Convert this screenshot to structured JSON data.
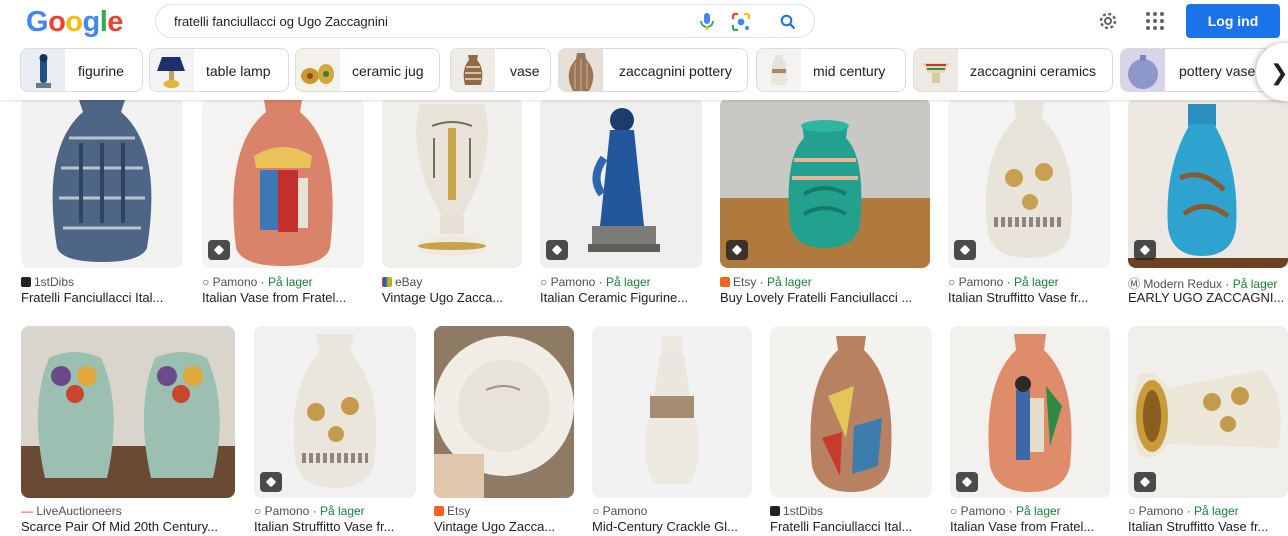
{
  "logo": {
    "letters": [
      "G",
      "o",
      "o",
      "g",
      "l",
      "e"
    ],
    "colors": [
      "#4285F4",
      "#EA4335",
      "#FBBC05",
      "#4285F4",
      "#34A853",
      "#EA4335"
    ]
  },
  "search": {
    "query": "fratelli fanciullacci og Ugo Zaccagnini",
    "icons": [
      "microphone-icon",
      "lens-icon",
      "search-icon"
    ]
  },
  "header": {
    "login_label": "Log ind",
    "settings_icon": "gear-icon",
    "apps_icon": "apps-grid-icon"
  },
  "chips": [
    {
      "label": "figurine"
    },
    {
      "label": "table lamp"
    },
    {
      "label": "ceramic jug"
    },
    {
      "label": "vase"
    },
    {
      "label": "zaccagnini pottery"
    },
    {
      "label": "mid century"
    },
    {
      "label": "zaccagnini ceramics"
    },
    {
      "label": "pottery vase"
    }
  ],
  "colors": {
    "accent": "#1a73e8",
    "stock": "#188038"
  },
  "results": [
    {
      "source": "1stDibs",
      "stock": "",
      "title": "Fratelli Fanciullacci Ital..."
    },
    {
      "source": "Pamono",
      "stock": "På lager",
      "title": "Italian Vase from Fratel..."
    },
    {
      "source": "eBay",
      "stock": "",
      "title": "Vintage Ugo Zacca..."
    },
    {
      "source": "Pamono",
      "stock": "På lager",
      "title": "Italian Ceramic Figurine..."
    },
    {
      "source": "Etsy",
      "stock": "På lager",
      "title": "Buy Lovely Fratelli Fanciullacci ..."
    },
    {
      "source": "Pamono",
      "stock": "På lager",
      "title": "Italian Struffitto Vase fr..."
    },
    {
      "source": "Modern Redux",
      "stock": "På lager",
      "title": "EARLY UGO ZACCAGNI..."
    },
    {
      "source": "LiveAuctioneers",
      "stock": "",
      "title": "Scarce Pair Of Mid 20th Century..."
    },
    {
      "source": "Pamono",
      "stock": "På lager",
      "title": "Italian Struffitto Vase fr..."
    },
    {
      "source": "Etsy",
      "stock": "",
      "title": "Vintage Ugo Zacca..."
    },
    {
      "source": "Pamono",
      "stock": "",
      "title": "Mid-Century Crackle Gl..."
    },
    {
      "source": "1stDibs",
      "stock": "",
      "title": "Fratelli Fanciullacci Ital..."
    },
    {
      "source": "Pamono",
      "stock": "På lager",
      "title": "Italian Vase from Fratel..."
    },
    {
      "source": "Pamono",
      "stock": "På lager",
      "title": "Italian Struffitto Vase fr..."
    }
  ]
}
